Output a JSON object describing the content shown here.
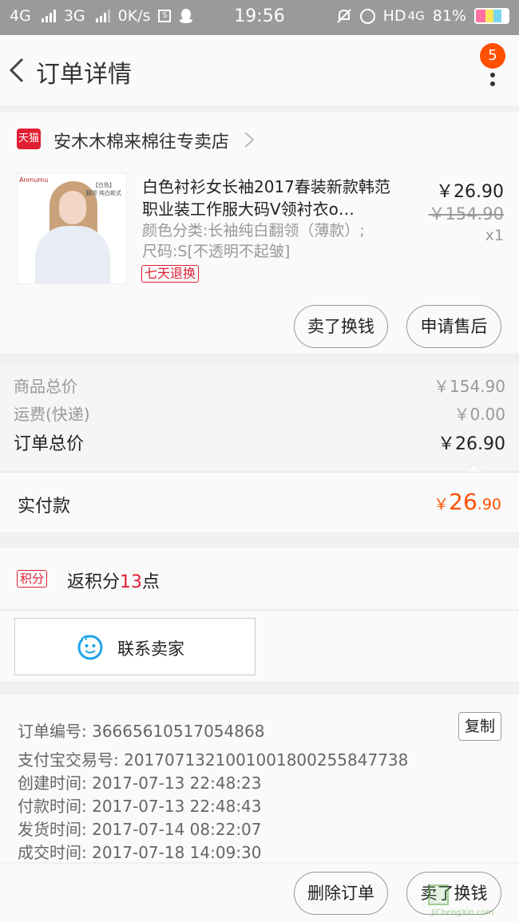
{
  "status_bar": {
    "net1": "4G",
    "net2": "3G",
    "speed": "0K/s",
    "s_box": "S",
    "time": "19:56",
    "hd": "HD",
    "net3": "4G",
    "battery": "81%",
    "icons": [
      "signal-icon",
      "qq-penguin-icon",
      "mute-icon",
      "alarm-icon",
      "battery-icon"
    ]
  },
  "header": {
    "title": "订单详情",
    "badge_count": "5"
  },
  "shop": {
    "tmall_label": "天猫",
    "name": "安木木棉来棉往专卖店"
  },
  "product": {
    "thumb_brand": "Anmumu",
    "thumb_tag": "【白色】\n翻领 纯白款式",
    "title": "白色衬衫女长袖2017春装新款韩范职业装工作服大码V领衬衣o…",
    "sku": "颜色分类:长袖纯白翻领（薄款）;尺码:S[不透明不起皱]",
    "return_tag": "七天退换",
    "price_now": "￥26.90",
    "price_old": "￥154.90",
    "qty": "x1",
    "btn_sell": "卖了换钱",
    "btn_after": "申请售后"
  },
  "summary": {
    "goods_label": "商品总价",
    "goods_value": "￥154.90",
    "shipping_label": "运费(快递)",
    "shipping_value": "￥0.00",
    "total_label": "订单总价",
    "total_value": "￥26.90"
  },
  "paid": {
    "label": "实付款",
    "yen": "￥",
    "integer": "26",
    "decimal": ".90"
  },
  "points": {
    "icon_label": "积分",
    "prefix": "返积分",
    "number": "13",
    "suffix": "点"
  },
  "contact": {
    "label": "联系卖家"
  },
  "info": {
    "order_no": "订单编号: 36665610517054868",
    "copy_label": "复制",
    "alipay_no": "支付宝交易号: 2017071321001001800255847738",
    "created": "创建时间: 2017-07-13 22:48:23",
    "paid": "付款时间: 2017-07-13 22:48:43",
    "shipped": "发货时间: 2017-07-14 08:22:07",
    "completed": "成交时间: 2017-07-18 14:09:30"
  },
  "bottom": {
    "delete_label": "删除订单",
    "sell_label": "卖了换钱"
  },
  "watermark": {
    "text": "JiChengXin.com"
  },
  "colors": {
    "accent": "#ff5000",
    "tmall_red": "#e01f33",
    "wangwang_blue": "#1fa3e6"
  }
}
